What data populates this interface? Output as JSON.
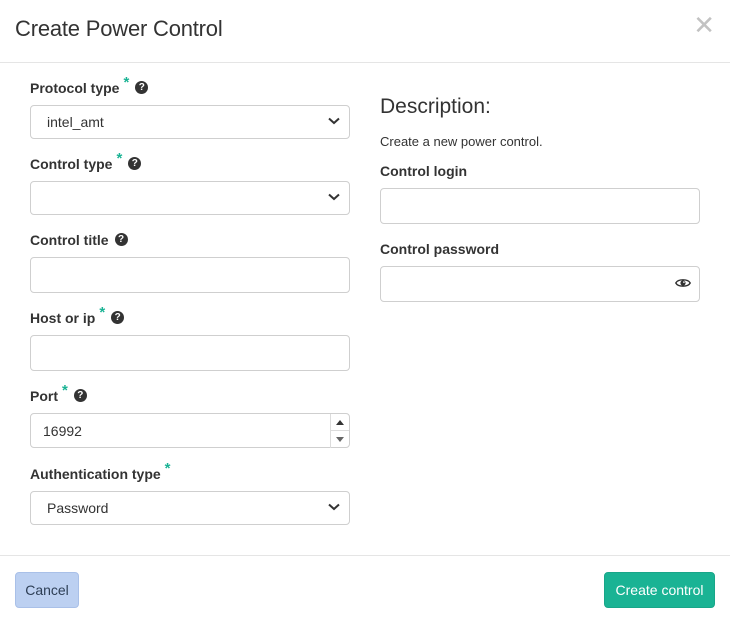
{
  "dialog": {
    "title": "Create Power Control",
    "close_glyph": "✕"
  },
  "required_mark": "*",
  "help_glyph": "?",
  "form": {
    "protocol_type": {
      "label": "Protocol type",
      "required": true,
      "help": true,
      "value": "intel_amt"
    },
    "control_type": {
      "label": "Control type",
      "required": true,
      "help": true,
      "value": ""
    },
    "control_title": {
      "label": "Control title",
      "required": false,
      "help": true,
      "value": ""
    },
    "host_or_ip": {
      "label": "Host or ip",
      "required": true,
      "help": true,
      "value": ""
    },
    "port": {
      "label": "Port",
      "required": true,
      "help": true,
      "value": "16992"
    },
    "authentication_type": {
      "label": "Authentication type",
      "required": true,
      "help": false,
      "value": "Password"
    }
  },
  "description": {
    "title": "Description:",
    "text": "Create a new power control.",
    "control_login": {
      "label": "Control login",
      "value": ""
    },
    "control_password": {
      "label": "Control password",
      "value": ""
    }
  },
  "footer": {
    "cancel_label": "Cancel",
    "create_label": "Create control"
  },
  "icons": {
    "chevron": "chevron-down-icon",
    "help": "question-circle-icon",
    "eye": "eye-icon",
    "close": "close-icon",
    "spin_up": "caret-up-icon",
    "spin_down": "caret-down-icon"
  },
  "colors": {
    "accent": "#1ab394",
    "cancel_bg": "#bcd0f1",
    "border": "#cfcfcf"
  }
}
